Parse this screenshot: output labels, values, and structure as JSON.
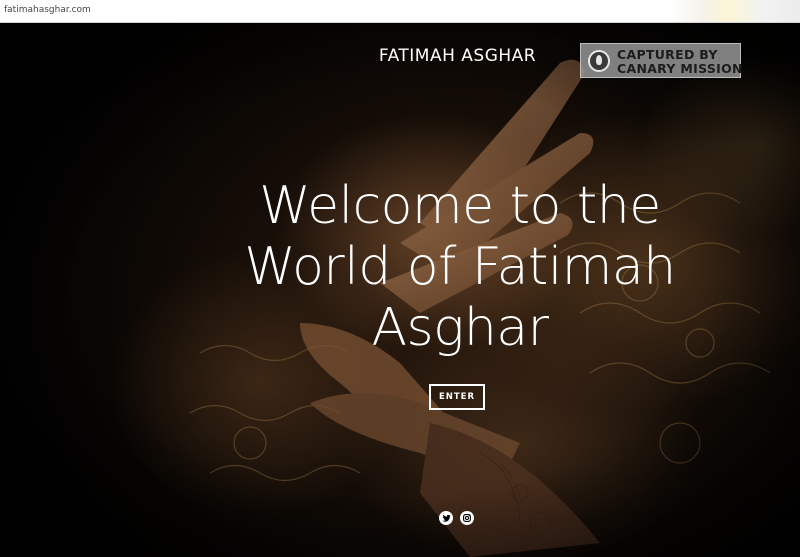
{
  "browser": {
    "url": "fatimahasghar.com"
  },
  "header": {
    "site_title": "FATIMAH ASGHAR"
  },
  "watermark": {
    "line1": "CAPTURED BY",
    "line2": "CANARY MISSION",
    "icon": "canary-mission-logo"
  },
  "hero": {
    "heading_lines": [
      "Welcome to the",
      "World of Fatimah",
      "Asghar"
    ],
    "enter_label": "ENTER"
  },
  "social": {
    "icons": [
      "twitter-icon",
      "instagram-icon"
    ]
  },
  "colors": {
    "text": "#ffffff",
    "background": "#000000"
  }
}
